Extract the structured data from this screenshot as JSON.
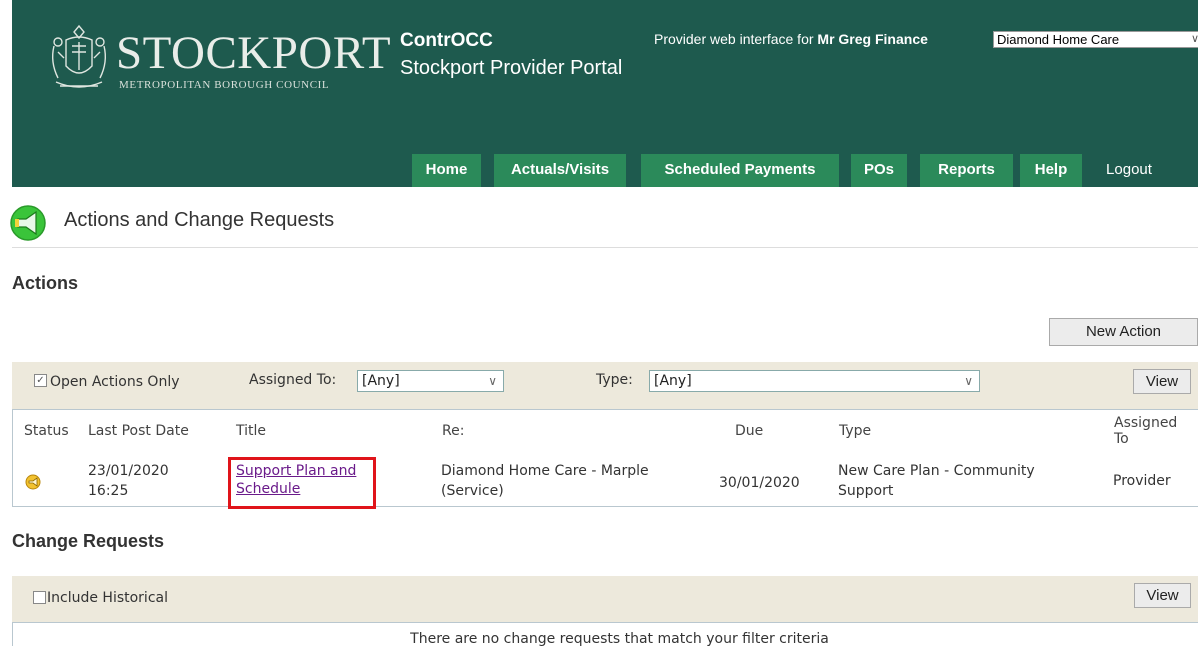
{
  "header": {
    "logo_title": "STOCKPORT",
    "logo_subtitle": "METROPOLITAN BOROUGH COUNCIL",
    "app_name": "ContrOCC",
    "portal_name": "Stockport Provider Portal",
    "provider_prefix": "Provider web interface for",
    "user_name": "Mr Greg Finance",
    "provider_selected": "Diamond Home Care"
  },
  "nav": {
    "items": [
      "Home",
      "Actuals/Visits",
      "Scheduled Payments",
      "POs",
      "Reports",
      "Help",
      "Logout"
    ]
  },
  "page": {
    "title": "Actions and Change Requests"
  },
  "actions": {
    "heading": "Actions",
    "new_action_label": "New Action",
    "filter": {
      "open_only_label": "Open Actions Only",
      "open_only_checked": true,
      "assigned_label": "Assigned To:",
      "assigned_value": "[Any]",
      "type_label": "Type:",
      "type_value": "[Any]",
      "view_label": "View"
    },
    "columns": [
      "Status",
      "Last Post Date",
      "Title",
      "Re:",
      "Due",
      "Type",
      "Assigned To"
    ],
    "rows": [
      {
        "status_icon": "action-status-icon",
        "last_post_date": "23/01/2020",
        "last_post_time": "16:25",
        "title_line1": "Support Plan and",
        "title_line2": "Schedule",
        "re_line1": "Diamond Home Care - Marple",
        "re_line2": "(Service)",
        "due": "30/01/2020",
        "type_line1": "New Care Plan - Community",
        "type_line2": "Support",
        "assigned_to": "Provider"
      }
    ]
  },
  "change_requests": {
    "heading": "Change Requests",
    "include_historical_label": "Include Historical",
    "include_historical_checked": false,
    "view_label": "View",
    "empty_message": "There are no change requests that match your filter criteria"
  },
  "colors": {
    "header_bg": "#1e5a4e",
    "nav_tab_bg": "#2b8a5a",
    "filter_bar_bg": "#ede9dc",
    "link": "#6a1a8a",
    "highlight": "#e0141a"
  }
}
